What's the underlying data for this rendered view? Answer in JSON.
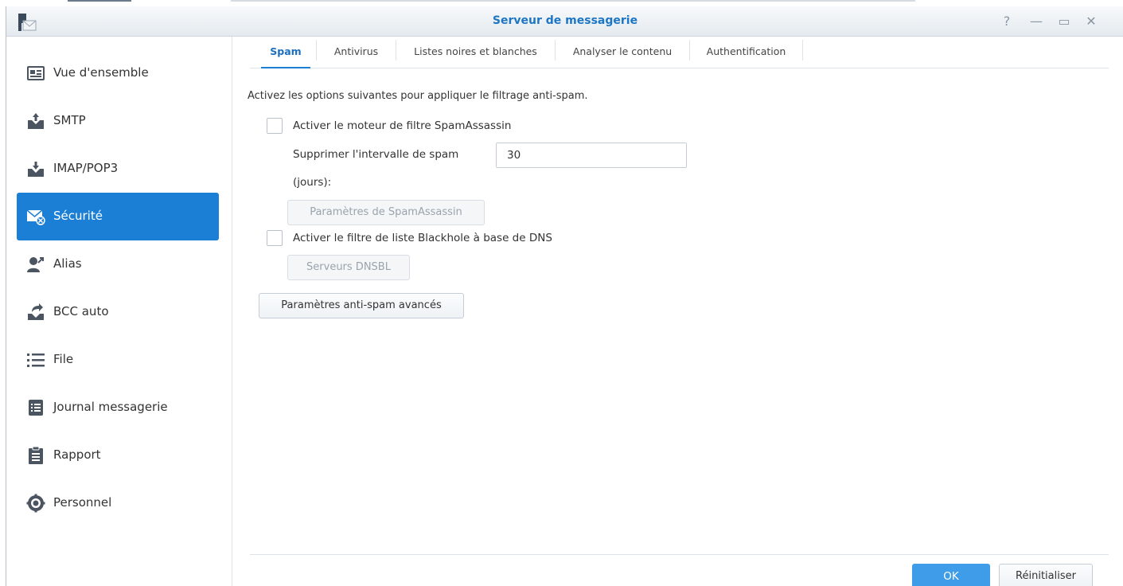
{
  "window": {
    "title": "Serveur de messagerie",
    "controls": {
      "help": "?",
      "minimize": "—",
      "maximize": "▭",
      "close": "✕"
    }
  },
  "sidebar": {
    "items": [
      {
        "label": "Vue d'ensemble",
        "icon": "overview-icon"
      },
      {
        "label": "SMTP",
        "icon": "smtp-icon"
      },
      {
        "label": "IMAP/POP3",
        "icon": "imap-icon"
      },
      {
        "label": "Sécurité",
        "icon": "security-icon",
        "active": true
      },
      {
        "label": "Alias",
        "icon": "alias-icon"
      },
      {
        "label": "BCC auto",
        "icon": "bcc-icon"
      },
      {
        "label": "File",
        "icon": "queue-icon"
      },
      {
        "label": "Journal messagerie",
        "icon": "log-icon"
      },
      {
        "label": "Rapport",
        "icon": "report-icon"
      },
      {
        "label": "Personnel",
        "icon": "personal-icon"
      }
    ]
  },
  "tabs": [
    {
      "label": "Spam",
      "active": true
    },
    {
      "label": "Antivirus"
    },
    {
      "label": "Listes noires et blanches"
    },
    {
      "label": "Analyser le contenu"
    },
    {
      "label": "Authentification"
    }
  ],
  "spam": {
    "description": "Activez les options suivantes pour appliquer le filtrage anti-spam.",
    "spamassassin_label": "Activer le moteur de filtre SpamAssassin",
    "interval_label_1": "Supprimer l'intervalle de spam",
    "interval_label_2": "(jours):",
    "interval_value": "30",
    "spamassassin_settings_button": "Paramètres de SpamAssassin",
    "dnsbl_label": "Activer le filtre de liste Blackhole à base de DNS",
    "dnsbl_servers_button": "Serveurs DNSBL",
    "advanced_button": "Paramètres anti-spam avancés"
  },
  "footer": {
    "ok": "OK",
    "reset": "Réinitialiser"
  },
  "colors": {
    "accent": "#1c7fd6",
    "title": "#1d76c4",
    "ok_button": "#3f9ce8"
  }
}
